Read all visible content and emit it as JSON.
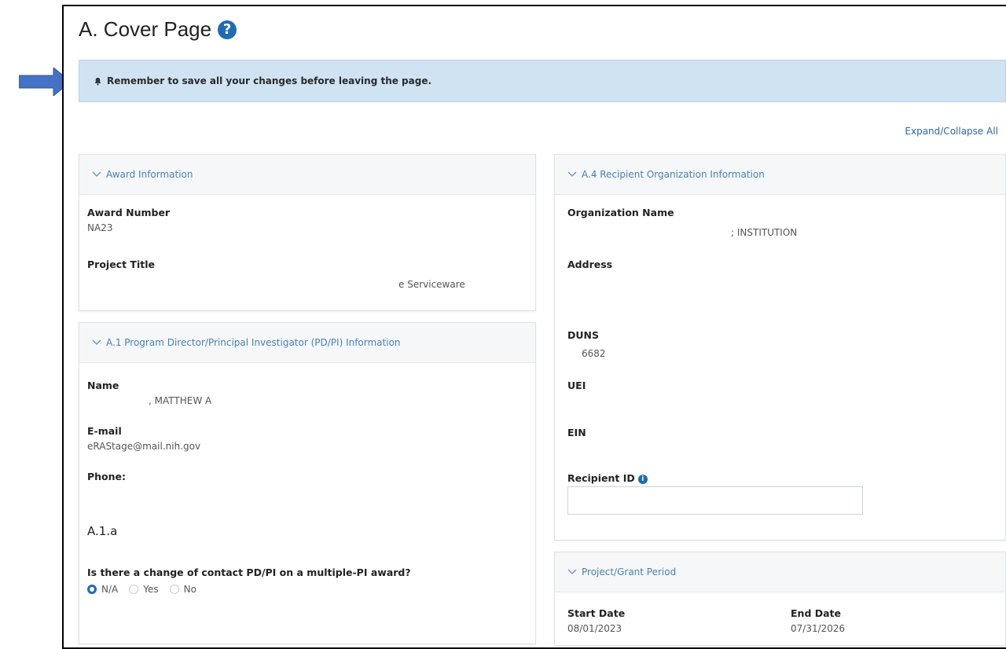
{
  "page": {
    "title": "A. Cover Page"
  },
  "alert": {
    "text": "Remember to save all your changes before leaving the page."
  },
  "toolbar": {
    "expand_collapse": "Expand/Collapse All"
  },
  "award_panel": {
    "header": "Award Information",
    "award_number_label": "Award Number",
    "award_number_value": "NA23",
    "project_title_label": "Project Title",
    "project_title_value": "e Serviceware"
  },
  "pdpi_panel": {
    "header": "A.1 Program Director/Principal Investigator (PD/PI) Information",
    "name_label": "Name",
    "name_value": ", MATTHEW A",
    "email_label": "E-mail",
    "email_value": "eRAStage@mail.nih.gov",
    "phone_label": "Phone:",
    "subsection": "A.1.a",
    "question": "Is there a change of contact PD/PI on a multiple-PI award?",
    "options": [
      "N/A",
      "Yes",
      "No"
    ],
    "selected": "N/A"
  },
  "org_panel": {
    "header": "A.4 Recipient Organization Information",
    "org_name_label": "Organization Name",
    "org_name_value": "; INSTITUTION",
    "address_label": "Address",
    "duns_label": "DUNS",
    "duns_value": "6682",
    "uei_label": "UEI",
    "ein_label": "EIN",
    "recipient_id_label": "Recipient ID",
    "recipient_id_value": ""
  },
  "period_panel": {
    "header": "Project/Grant Period",
    "start_label": "Start Date",
    "start_value": "08/01/2023",
    "end_label": "End Date",
    "end_value": "07/31/2026"
  },
  "colors": {
    "accent": "#1f6bb3",
    "alert_bg": "#cfe3f2",
    "arrow": "#4472c4"
  }
}
